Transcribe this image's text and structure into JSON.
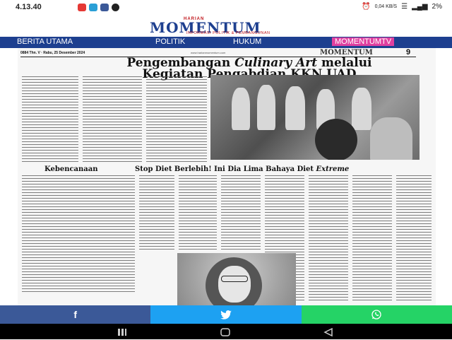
{
  "status_bar": {
    "time": "4.13.40",
    "net_speed": "0,04 KB/S",
    "battery": "2%"
  },
  "header": {
    "logo_top": "HARIAN",
    "logo_main": "MOMENTUM",
    "logo_tagline": "INFORMASI POLITIK & PEMBANGUNAN"
  },
  "nav": {
    "items": [
      "BERITA UTAMA",
      "POLITIK",
      "HUKUM",
      "MOMENTUMTV"
    ]
  },
  "paper": {
    "meta": "0884 Thn. V · Rabu, 25 Desember 2024",
    "url": "www.harianmomentum.com",
    "mini_logo": "MOMENTUM",
    "page_number": "9",
    "headline_line1_a": "Pengembangan ",
    "headline_line1_b": "Culinary Art",
    "headline_line1_c": " melalui",
    "headline_line2": "Kegiatan Pengabdian KKN UAD",
    "section_title": "Kebencanaan",
    "sub_headline_a": "Stop Diet Berlebih! Ini Dia Lima Bahaya Diet ",
    "sub_headline_b": "Extreme"
  },
  "share": {
    "facebook_icon": "f",
    "twitter_icon": "twitter-bird",
    "whatsapp_icon": "whatsapp",
    "colors": {
      "facebook": "#3b5998",
      "twitter": "#1da1f2",
      "whatsapp": "#25d366"
    }
  },
  "colors": {
    "brand_blue": "#1d3f8f",
    "brand_red": "#c0151b",
    "nav_highlight": "#e040a0"
  }
}
